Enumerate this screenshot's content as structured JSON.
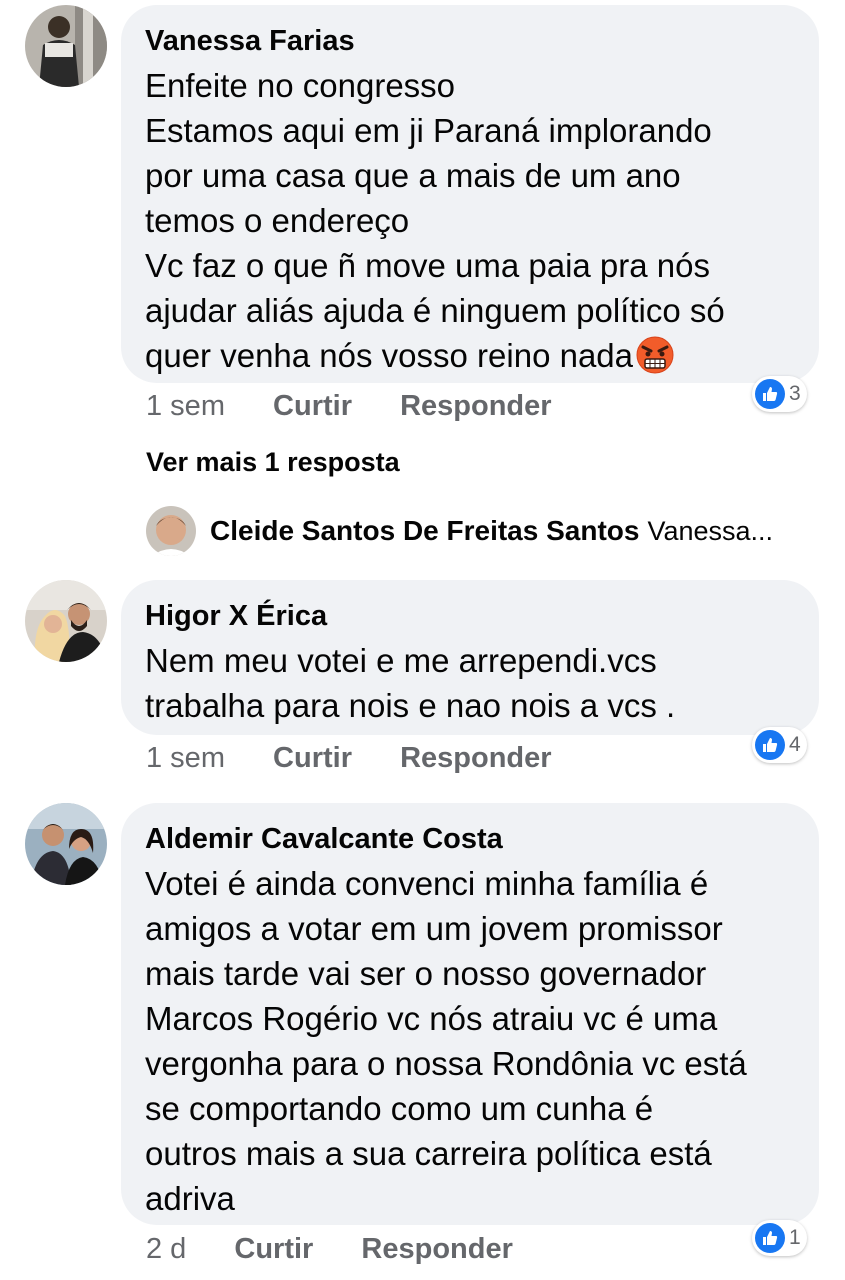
{
  "comments": [
    {
      "author": "Vanessa Farias",
      "lines": [
        "Enfeite no congresso",
        "Estamos aqui em ji Paraná implorando",
        "por uma casa que a mais de um ano",
        "temos o endereço",
        "Vc faz o que ñ move uma paia pra nós",
        "ajudar aliás ajuda é ninguem político só",
        "quer venha nós vosso reino nada"
      ],
      "emoji": "angry-face-emoji",
      "time": "1 sem",
      "like_label": "Curtir",
      "reply_label": "Responder",
      "reaction_count": "3"
    },
    {
      "author": "Higor X Érica",
      "lines": [
        "Nem meu votei e me arrependi.vcs",
        "trabalha para nois e nao nois a vcs ."
      ],
      "time": "1 sem",
      "like_label": "Curtir",
      "reply_label": "Responder",
      "reaction_count": "4"
    },
    {
      "author": "Aldemir Cavalcante Costa",
      "lines": [
        "Votei é ainda convenci minha família é",
        "amigos a votar em um jovem promissor",
        "mais tarde vai ser o nosso governador",
        "Marcos Rogério vc nós atraiu vc é uma",
        "vergonha para o nossa Rondônia vc está",
        "se comportando como um cunha é",
        "outros mais a sua carreira política está",
        "adriva"
      ],
      "time": "2 d",
      "like_label": "Curtir",
      "reply_label": "Responder",
      "reaction_count": "1"
    }
  ],
  "replies": {
    "view_more_label": "Ver mais 1 resposta",
    "preview_author": "Cleide Santos De Freitas Santos",
    "preview_snippet": "Vanessa..."
  },
  "colors": {
    "bubble_bg": "#f0f2f5",
    "meta_text": "#65676b",
    "like_blue": "#1877f2",
    "primary_text": "#050505"
  }
}
